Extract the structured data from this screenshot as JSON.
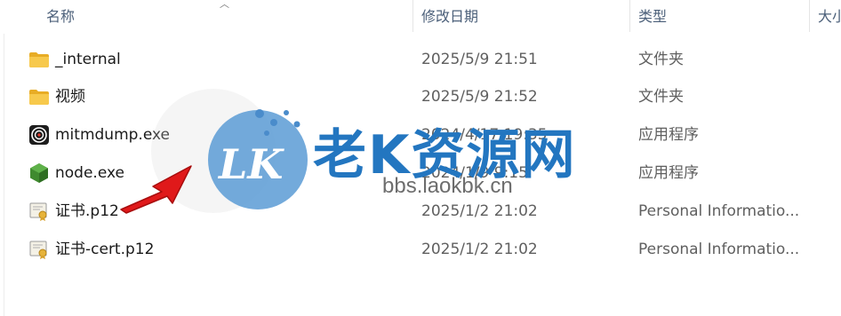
{
  "columns": {
    "name": "名称",
    "date": "修改日期",
    "type": "类型",
    "size": "大小"
  },
  "files": [
    {
      "name": "_internal",
      "date": "2025/5/9 21:51",
      "type": "文件夹",
      "icon": "folder-icon"
    },
    {
      "name": "视频",
      "date": "2025/5/9 21:52",
      "type": "文件夹",
      "icon": "folder-icon"
    },
    {
      "name": "mitmdump.exe",
      "date": "2024/4/17 19:35",
      "type": "应用程序",
      "icon": "mitmdump-app-icon"
    },
    {
      "name": "node.exe",
      "date": "2024/1/9 9:15",
      "type": "应用程序",
      "icon": "nodejs-app-icon"
    },
    {
      "name": "证书.p12",
      "date": "2025/1/2 21:02",
      "type": "Personal Informatio...",
      "icon": "certificate-file-icon"
    },
    {
      "name": "证书-cert.p12",
      "date": "2025/1/2 21:02",
      "type": "Personal Informatio...",
      "icon": "certificate-file-icon"
    }
  ],
  "watermark": {
    "logo_letters": "LK",
    "site_name": "老K资源网",
    "url": "bbs.laokbk.cn"
  },
  "colors": {
    "folder": "#f5c443",
    "arrow": "#e0191a",
    "watermark_blue": "#2376c0",
    "header_text": "#4c607a"
  }
}
